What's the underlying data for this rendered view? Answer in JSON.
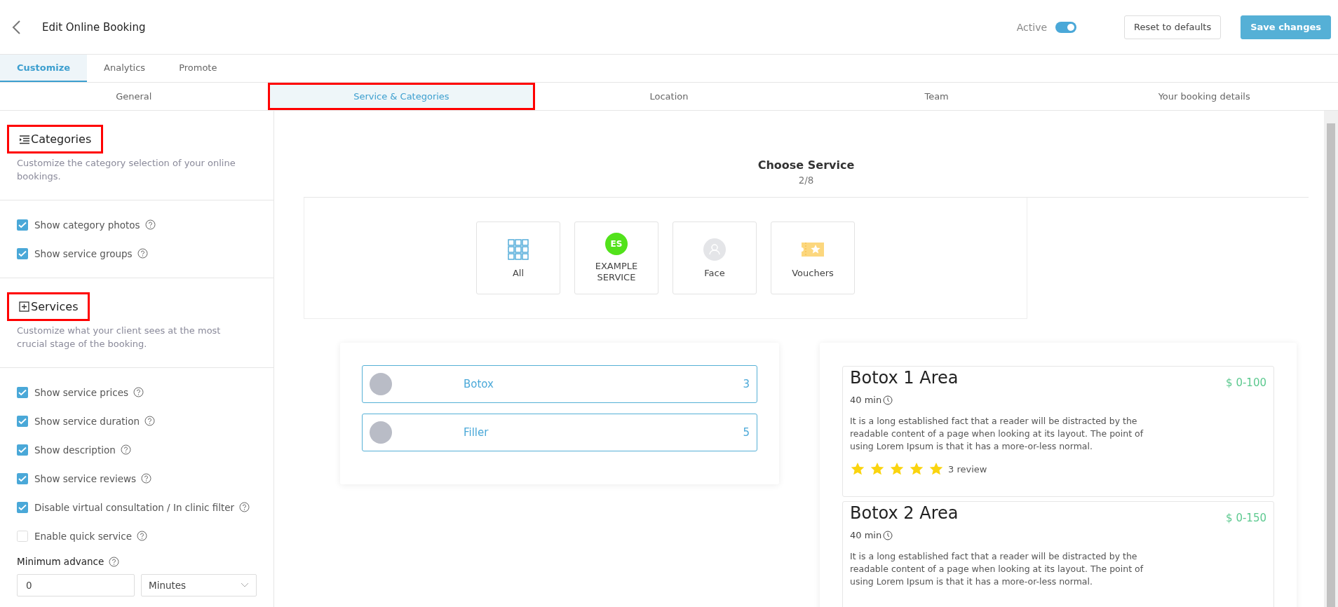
{
  "header": {
    "title": "Edit Online Booking",
    "active_label": "Active",
    "active_on": true,
    "buttons": [
      {
        "label": "Reset to defaults",
        "kind": "secondary"
      },
      {
        "label": "Save changes",
        "kind": "primary"
      }
    ]
  },
  "tabs": [
    {
      "label": "Customize",
      "selected": true
    },
    {
      "label": "Analytics",
      "selected": false
    },
    {
      "label": "Promote",
      "selected": false
    }
  ],
  "subtabs": [
    {
      "label": "General",
      "selected": false,
      "highlighted": false
    },
    {
      "label": "Service & Categories",
      "selected": true,
      "highlighted": true
    },
    {
      "label": "Location",
      "selected": false,
      "highlighted": false
    },
    {
      "label": "Team",
      "selected": false,
      "highlighted": false
    },
    {
      "label": "Your booking details",
      "selected": false,
      "highlighted": false
    }
  ],
  "sidebar": {
    "sections": [
      {
        "title": "Categories",
        "highlighted": true,
        "description": "Customize the category selection of your online bookings.",
        "options": [
          {
            "label": "Show category photos",
            "checked": true
          },
          {
            "label": "Show service groups",
            "checked": true
          }
        ]
      },
      {
        "title": "Services",
        "highlighted": true,
        "description": "Customize what your client sees at the most crucial stage of the booking.",
        "options": [
          {
            "label": "Show service prices",
            "checked": true
          },
          {
            "label": "Show service duration",
            "checked": true
          },
          {
            "label": "Show description",
            "checked": true
          },
          {
            "label": "Show service reviews",
            "checked": true
          },
          {
            "label": "Disable virtual consultation / In clinic filter",
            "checked": true
          },
          {
            "label": "Enable quick service",
            "checked": false
          }
        ]
      }
    ],
    "minimum_advance": {
      "label": "Minimum advance",
      "value": "0",
      "unit": "Minutes"
    }
  },
  "preview": {
    "title": "Choose Service",
    "step": "2/8",
    "categories": [
      {
        "label": "All",
        "kind": "grid"
      },
      {
        "label": "EXAMPLE SERVICE",
        "kind": "initials",
        "initials": "ES",
        "color": "#52e21b"
      },
      {
        "label": "Face",
        "kind": "person"
      },
      {
        "label": "Vouchers",
        "kind": "voucher"
      }
    ],
    "groups": [
      {
        "name": "Botox",
        "count": "3"
      },
      {
        "name": "Filler",
        "count": "5"
      }
    ],
    "services": [
      {
        "name": "Botox 1 Area",
        "price": "$ 0-100",
        "duration": "40 min",
        "description": "It is a long established fact that a reader will be distracted by the readable content of a page when looking at its layout. The point of using Lorem Ipsum is that it has a more-or-less normal.",
        "stars": 5,
        "reviews": "3 review"
      },
      {
        "name": "Botox 2 Area",
        "price": "$ 0-150",
        "duration": "40 min",
        "description": "It is a long established fact that a reader will be distracted by the readable content of a page when looking at its layout. The point of using Lorem Ipsum is that it has a more-or-less normal."
      }
    ]
  }
}
